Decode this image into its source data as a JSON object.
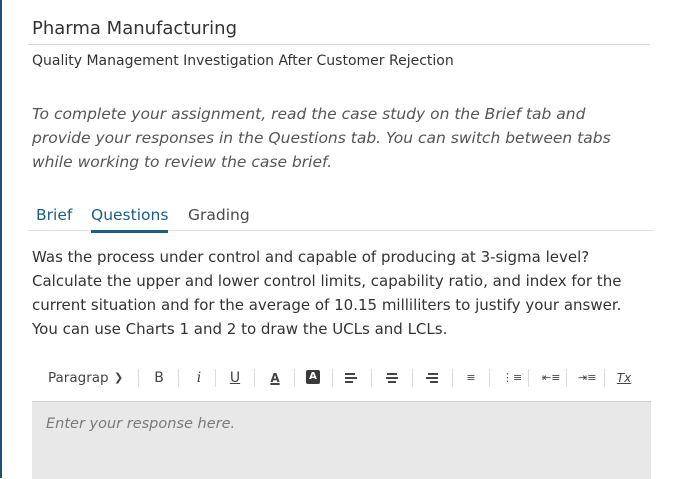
{
  "header": {
    "title": "Pharma Manufacturing",
    "subtitle": "Quality Management Investigation After Customer Rejection"
  },
  "instructions": "To complete your assignment, read the case study on the Brief tab and provide your responses in the Questions tab. You can switch between tabs while working to review the case brief.",
  "tabs": [
    {
      "label": "Brief",
      "active": false
    },
    {
      "label": "Questions",
      "active": true
    },
    {
      "label": "Grading",
      "active": false
    }
  ],
  "question": "Was the process under control and capable of producing at 3-sigma level? Calculate the upper and lower control limits, capability ratio, and index for the current situation and for the average of 10.15 milliliters to justify your answer. You can use Charts 1 and 2 to draw the UCLs and LCLs.",
  "toolbar": {
    "paragraph_label": "Paragrap",
    "bold_label": "B",
    "italic_label": "i",
    "underline_label": "U",
    "font_color_label": "A",
    "bg_color_label": "A",
    "clear_format_label": "Tx"
  },
  "editor": {
    "placeholder": "Enter your response here."
  },
  "colors": {
    "accent": "#1a5e8a",
    "editor_bg": "#e8e8e8"
  }
}
